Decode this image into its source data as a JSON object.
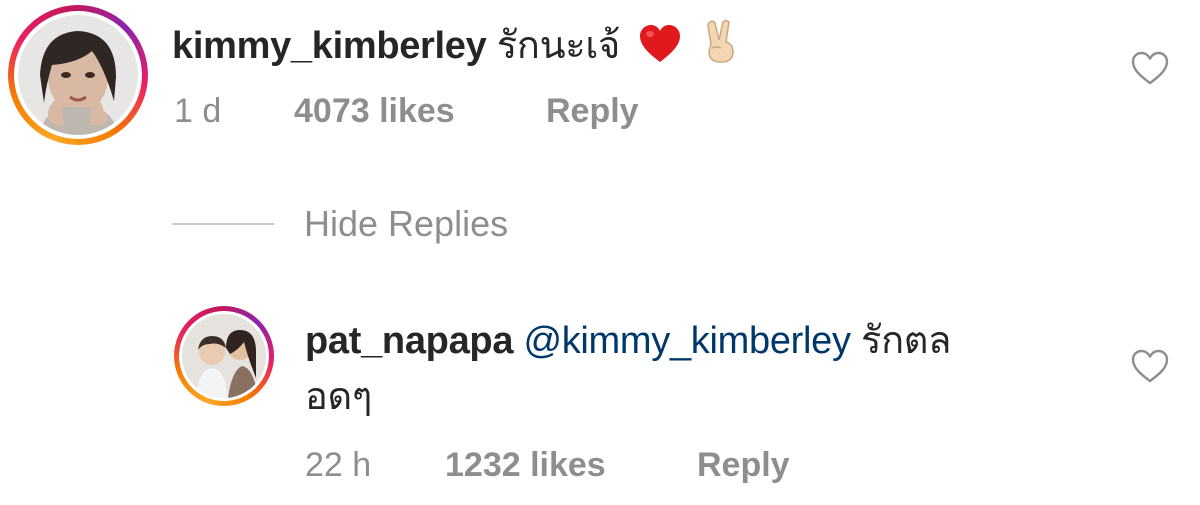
{
  "comments": [
    {
      "username": "kimmy_kimberley",
      "text": "รักนะเจ้",
      "emojis": [
        "red-heart-emoji",
        "victory-hand-emoji"
      ],
      "time": "1 d",
      "likes": "4073 likes",
      "reply_label": "Reply",
      "avatar_icon": "avatar"
    }
  ],
  "thread_toggle": {
    "label": "Hide Replies"
  },
  "replies": [
    {
      "username": "pat_napapa",
      "mention": "@kimmy_kimberley",
      "text_line1": "รักตล",
      "text_line2": "อดๆ",
      "time": "22 h",
      "likes": "1232 likes",
      "reply_label": "Reply",
      "avatar_icon": "avatar"
    }
  ],
  "colors": {
    "username": "#262626",
    "mention": "#00376b",
    "meta": "#8e8e8e",
    "heart_outline": "#8e8e8e",
    "emoji_heart": "#e0191d"
  }
}
